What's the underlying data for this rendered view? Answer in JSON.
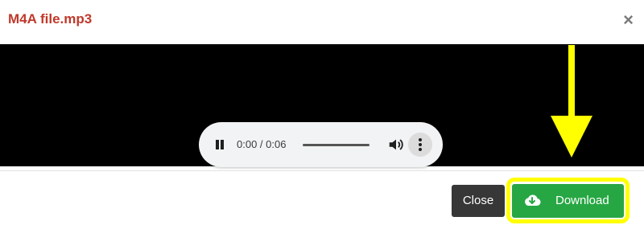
{
  "dialog": {
    "title": "M4A file.mp3",
    "close_glyph": "×"
  },
  "audio_player": {
    "time_display": "0:00 / 0:06",
    "state": "playing",
    "icons": [
      "pause-icon",
      "volume-icon",
      "more-options-icon"
    ]
  },
  "footer": {
    "close_label": "Close",
    "download_label": "Download"
  },
  "annotation": {
    "highlight_color": "#ffff00",
    "arrow_color": "#ffff00"
  },
  "colors": {
    "title": "#c0392b",
    "video_background": "#000000",
    "download_button": "#27a744",
    "close_button": "#373737"
  }
}
